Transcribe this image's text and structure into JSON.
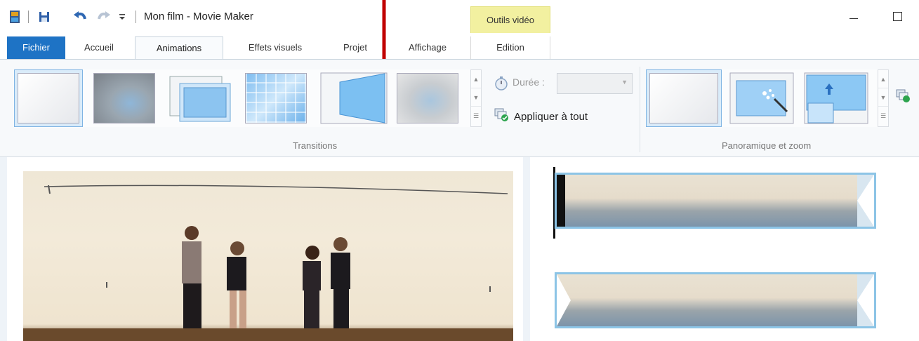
{
  "window": {
    "title": "Mon film - Movie Maker",
    "context_group": "Outils vidéo"
  },
  "tabs": [
    {
      "label": "Fichier"
    },
    {
      "label": "Accueil"
    },
    {
      "label": "Animations"
    },
    {
      "label": "Effets visuels"
    },
    {
      "label": "Projet"
    },
    {
      "label": "Affichage"
    },
    {
      "label": "Edition"
    }
  ],
  "ribbon": {
    "transitions": {
      "group_label": "Transitions",
      "items": [
        "no-transition",
        "fade",
        "cross-zoom",
        "mosaic",
        "sweep",
        "dissolve"
      ]
    },
    "duree_label": "Durée :",
    "duree_value": "",
    "apply_all_label": "Appliquer à tout",
    "panzoom": {
      "group_label": "Panoramique et zoom",
      "items": [
        "no-pan-zoom",
        "automatic",
        "pan-up"
      ]
    }
  },
  "colors": {
    "fichier_tab": "#1e73c5",
    "context_group": "#f2f0a0",
    "selection": "#d9ebf9",
    "clip_border": "#8cc4e6",
    "annotation_arrow": "#c00000"
  },
  "icons": {
    "app": "film-icon",
    "save": "save-icon",
    "undo": "undo-icon",
    "redo": "redo-icon",
    "customize": "qat-dropdown-icon",
    "minimize": "minimize-icon",
    "maximize": "maximize-icon",
    "timer": "timer-icon",
    "apply": "apply-all-icon"
  }
}
